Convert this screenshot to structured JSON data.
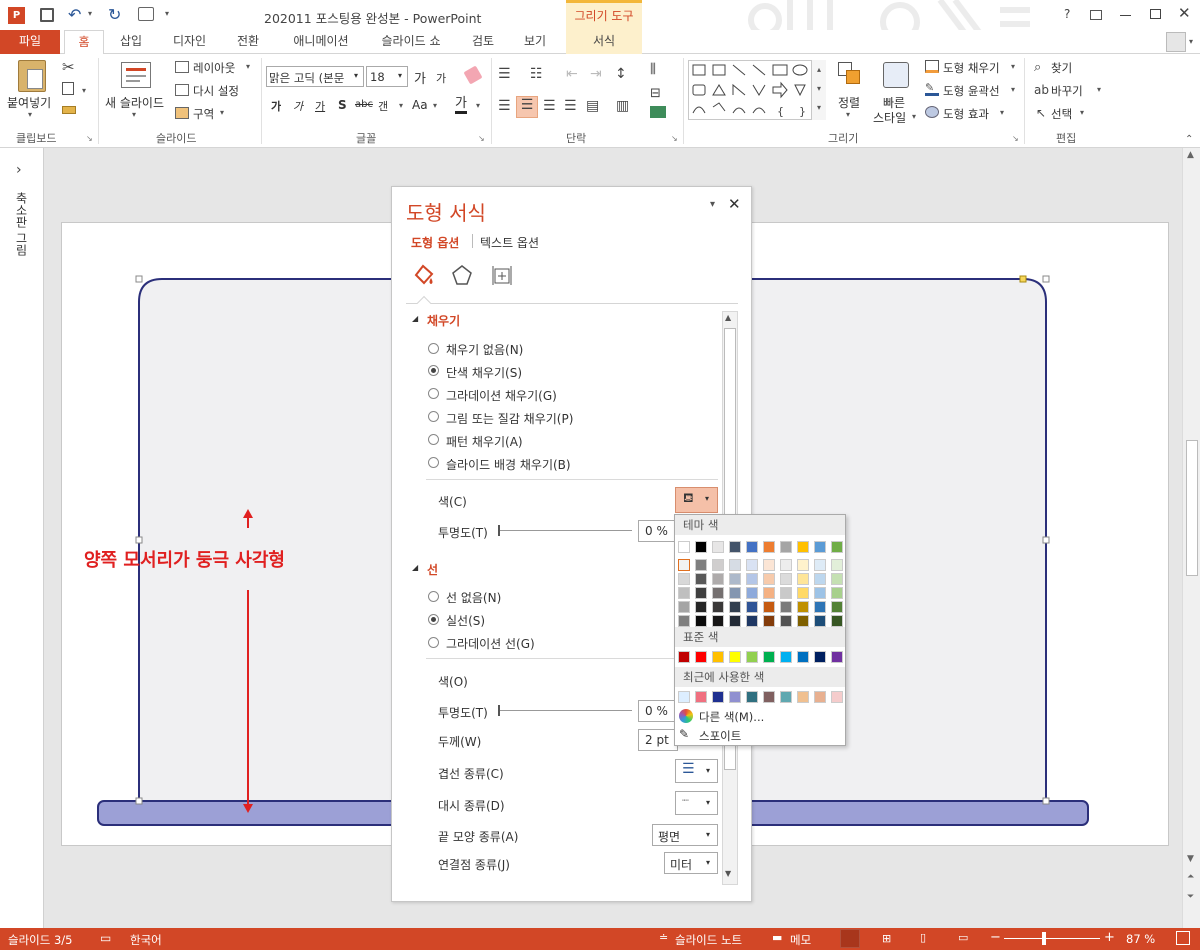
{
  "window": {
    "title": "202011 포스팅용 완성본 - PowerPoint",
    "context_tab_group": "그리기 도구",
    "help": "?"
  },
  "tabs": [
    "파일",
    "홈",
    "삽입",
    "디자인",
    "전환",
    "애니메이션",
    "슬라이드 쇼",
    "검토",
    "보기",
    "서식"
  ],
  "ribbon": {
    "clipboard": {
      "paste": "붙여넣기",
      "label": "클립보드"
    },
    "slides": {
      "new_slide": "새 슬라이드",
      "layout": "레이아웃",
      "reset": "다시 설정",
      "section": "구역",
      "label": "슬라이드"
    },
    "font": {
      "font_name": "맑은 고딕 (본문",
      "font_size": "18",
      "label": "글꼴",
      "bold": "가",
      "italic": "가",
      "underline": "가",
      "shadow": "S",
      "strike": "abc",
      "spacing": "갠",
      "case": "Aa",
      "color": "가",
      "grow": "가",
      "shrink": "가"
    },
    "paragraph": {
      "label": "단락"
    },
    "drawing": {
      "arrange": "정렬",
      "quick_styles_1": "빠른",
      "quick_styles_2": "스타일",
      "shape_fill": "도형 채우기",
      "shape_outline": "도형 윤곽선",
      "shape_effects": "도형 효과",
      "label": "그리기"
    },
    "editing": {
      "find": "찾기",
      "replace": "바꾸기",
      "select": "선택",
      "label": "편집"
    }
  },
  "left_pane": {
    "label": "축소판 그림",
    "expand": "›"
  },
  "annotation": {
    "text": "양쪽 모서리가 둥극 사각형",
    "color": "#e02020"
  },
  "format_pane": {
    "title": "도형 서식",
    "tabs": [
      "도형 옵션",
      "텍스트 옵션"
    ],
    "fill_section": "채우기",
    "fill_options": [
      {
        "label": "채우기 없음(N)",
        "selected": false
      },
      {
        "label": "단색 채우기(S)",
        "selected": true
      },
      {
        "label": "그라데이션 채우기(G)",
        "selected": false
      },
      {
        "label": "그림 또는 질감 채우기(P)",
        "selected": false
      },
      {
        "label": "패턴 채우기(A)",
        "selected": false
      },
      {
        "label": "슬라이드 배경 채우기(B)",
        "selected": false
      }
    ],
    "fill_color_label": "색(C)",
    "fill_transparency_label": "투명도(T)",
    "fill_transparency_value": "0 %",
    "line_section": "선",
    "line_options": [
      {
        "label": "선 없음(N)",
        "selected": false
      },
      {
        "label": "실선(S)",
        "selected": true
      },
      {
        "label": "그라데이션 선(G)",
        "selected": false
      }
    ],
    "line_color_label": "색(O)",
    "line_transparency_label": "투명도(T)",
    "line_transparency_value": "0 %",
    "width_label": "두께(W)",
    "width_value": "2 pt",
    "compound_label": "겹선 종류(C)",
    "dash_label": "대시 종류(D)",
    "cap_label": "끝 모양 종류(A)",
    "cap_value": "평면",
    "join_label": "연결점 종류(J)",
    "join_value": "미터"
  },
  "palette": {
    "theme_header": "테마 색",
    "standard_header": "표준 색",
    "recent_header": "최근에 사용한 색",
    "more_colors": "다른 색(M)...",
    "eyedropper": "스포이트",
    "theme_colors": [
      [
        "#ffffff",
        "#000000",
        "#e7e6e6",
        "#44546a",
        "#4472c4",
        "#ed7d31",
        "#a5a5a5",
        "#ffc000",
        "#5b9bd5",
        "#70ad47"
      ],
      [
        "#f2f2f2",
        "#7f7f7f",
        "#d0cece",
        "#d6dce4",
        "#d9e2f3",
        "#fbe5d5",
        "#ededed",
        "#fff2cc",
        "#deebf6",
        "#e2efd9"
      ],
      [
        "#d8d8d8",
        "#595959",
        "#aeabab",
        "#adb9ca",
        "#b4c6e7",
        "#f7cbac",
        "#dbdbdb",
        "#fee599",
        "#bdd7ee",
        "#c5e0b3"
      ],
      [
        "#bfbfbf",
        "#3f3f3f",
        "#757070",
        "#8496b0",
        "#8eaadb",
        "#f4b183",
        "#c9c9c9",
        "#ffd966",
        "#9dc3e6",
        "#a8d08d"
      ],
      [
        "#a5a5a5",
        "#262626",
        "#3a3838",
        "#323f4f",
        "#2f5496",
        "#c55a11",
        "#7b7b7b",
        "#bf9000",
        "#2e75b5",
        "#538135"
      ],
      [
        "#7f7f7f",
        "#0c0c0c",
        "#171616",
        "#222a35",
        "#1f3864",
        "#833c0b",
        "#525252",
        "#7f6000",
        "#1e4e79",
        "#375623"
      ]
    ],
    "standard_colors": [
      "#c00000",
      "#ff0000",
      "#ffc000",
      "#ffff00",
      "#92d050",
      "#00b050",
      "#00b0f0",
      "#0070c0",
      "#002060",
      "#7030a0"
    ],
    "recent_colors": [
      "#ddeeff",
      "#f07080",
      "#1f3090",
      "#9090d0",
      "#307080",
      "#806060",
      "#60a8b0",
      "#f0c090",
      "#e8b090",
      "#f5cccc"
    ]
  },
  "status": {
    "slide": "슬라이드 3/5",
    "language": "한국어",
    "notes": "슬라이드 노트",
    "comments": "메모",
    "zoom": "87 %"
  }
}
